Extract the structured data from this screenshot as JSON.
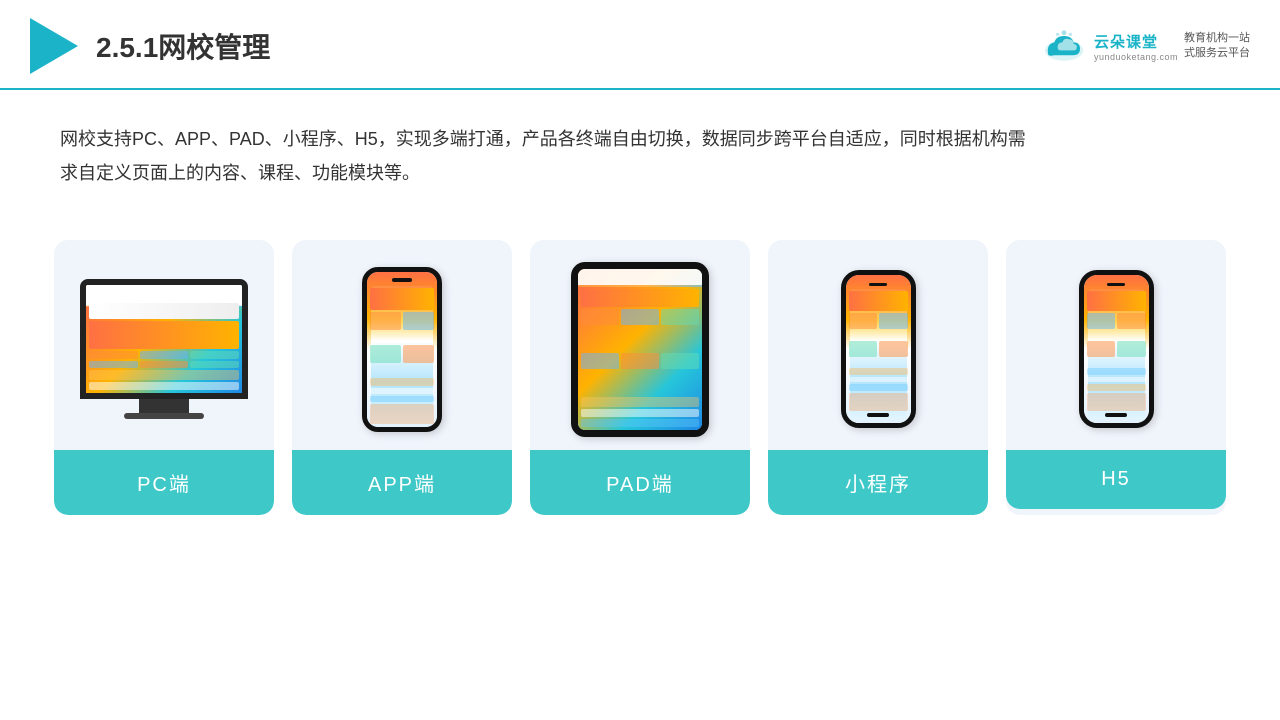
{
  "header": {
    "title": "2.5.1网校管理",
    "logo": {
      "name": "云朵课堂",
      "url": "yunduoketang.com",
      "slogan": "教育机构一站\n式服务云平台"
    }
  },
  "description": {
    "text": "网校支持PC、APP、PAD、小程序、H5，实现多端打通，产品各终端自由切换，数据同步跨平台自适应，同时根据机构需求自定义页面上的内容、课程、功能模块等。"
  },
  "cards": [
    {
      "id": "pc",
      "label": "PC端"
    },
    {
      "id": "app",
      "label": "APP端"
    },
    {
      "id": "pad",
      "label": "PAD端"
    },
    {
      "id": "miniprogram",
      "label": "小程序"
    },
    {
      "id": "h5",
      "label": "H5"
    }
  ]
}
